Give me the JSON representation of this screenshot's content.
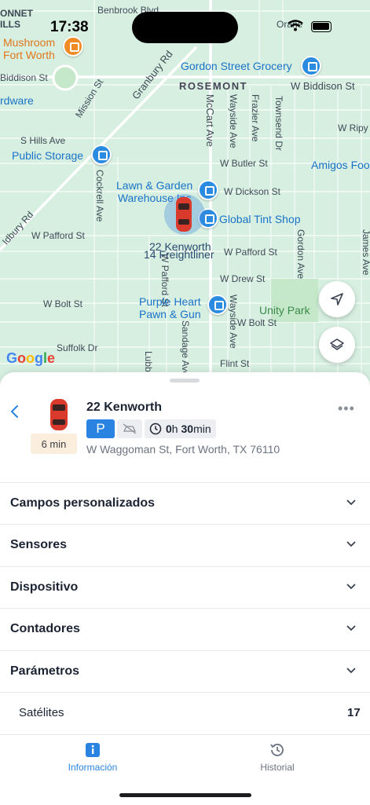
{
  "status_bar": {
    "time": "17:38"
  },
  "map": {
    "streets": [
      "Benbrook Blvd",
      "Granbury Rd",
      "Mission St",
      "ROSEMONT",
      "W Biddison St",
      "McCart Ave",
      "Wayside Ave",
      "Frazier Ave",
      "Townsend Dr",
      "W Ripy St",
      "S Hills Ave",
      "W Butler St",
      "W Dickson St",
      "Cockrell Ave",
      "W Pafford St",
      "W Pafford St",
      "Gordon Ave",
      "James Ave",
      "W Drew St",
      "W Bolt St",
      "W Bolt St",
      "Suffolk Dr",
      "Flint St",
      "Sandage Ave",
      "Wayside Ave",
      "Lubbock Ave",
      "Idbury Rd",
      "Biddison St",
      "ONNET",
      "ILLS",
      "Orane"
    ],
    "pois": [
      {
        "name": "Mushroom\nFort Worth",
        "icon": "food-icon"
      },
      {
        "name": "Gordon Street Grocery",
        "icon": "shopping-bag-icon"
      },
      {
        "name": "Public Storage",
        "icon": "shopping-bag-icon"
      },
      {
        "name": "Lawn & Garden\nWarehouse Inc",
        "icon": "shopping-bag-icon"
      },
      {
        "name": "Global Tint Shop",
        "icon": "shopping-bag-icon"
      },
      {
        "name": "Purple Heart\nPawn & Gun",
        "icon": "shopping-bag-icon"
      },
      {
        "name": "Unity Park",
        "icon": "park-icon"
      },
      {
        "name": "Amigos Foo",
        "icon": ""
      },
      {
        "name": "rdware",
        "icon": ""
      }
    ],
    "vehicle_labels": [
      "22 Kenworth",
      "14 Freightliner"
    ],
    "attribution": "Google"
  },
  "vehicle": {
    "name": "22 Kenworth",
    "eta": "6 min",
    "parking_badge": "P",
    "duration_hours": "0",
    "duration_hours_unit": "h",
    "duration_minutes": "30",
    "duration_minutes_unit": "min",
    "address": "W Waggoman St, Fort Worth, TX 76110"
  },
  "sections": [
    {
      "label": "Campos personalizados"
    },
    {
      "label": "Sensores"
    },
    {
      "label": "Dispositivo"
    },
    {
      "label": "Contadores"
    },
    {
      "label": "Parámetros"
    }
  ],
  "parameters": [
    {
      "label": "Satélites",
      "value": "17"
    }
  ],
  "tabs": [
    {
      "label": "Información",
      "icon": "info-icon",
      "active": true,
      "color": "#2a83e0"
    },
    {
      "label": "Historial",
      "icon": "history-icon",
      "active": false,
      "color": "#6b7380"
    }
  ],
  "colors": {
    "accent": "#2a83e0",
    "map_background": "#d6efe0",
    "eta_background": "#fbeedd"
  }
}
